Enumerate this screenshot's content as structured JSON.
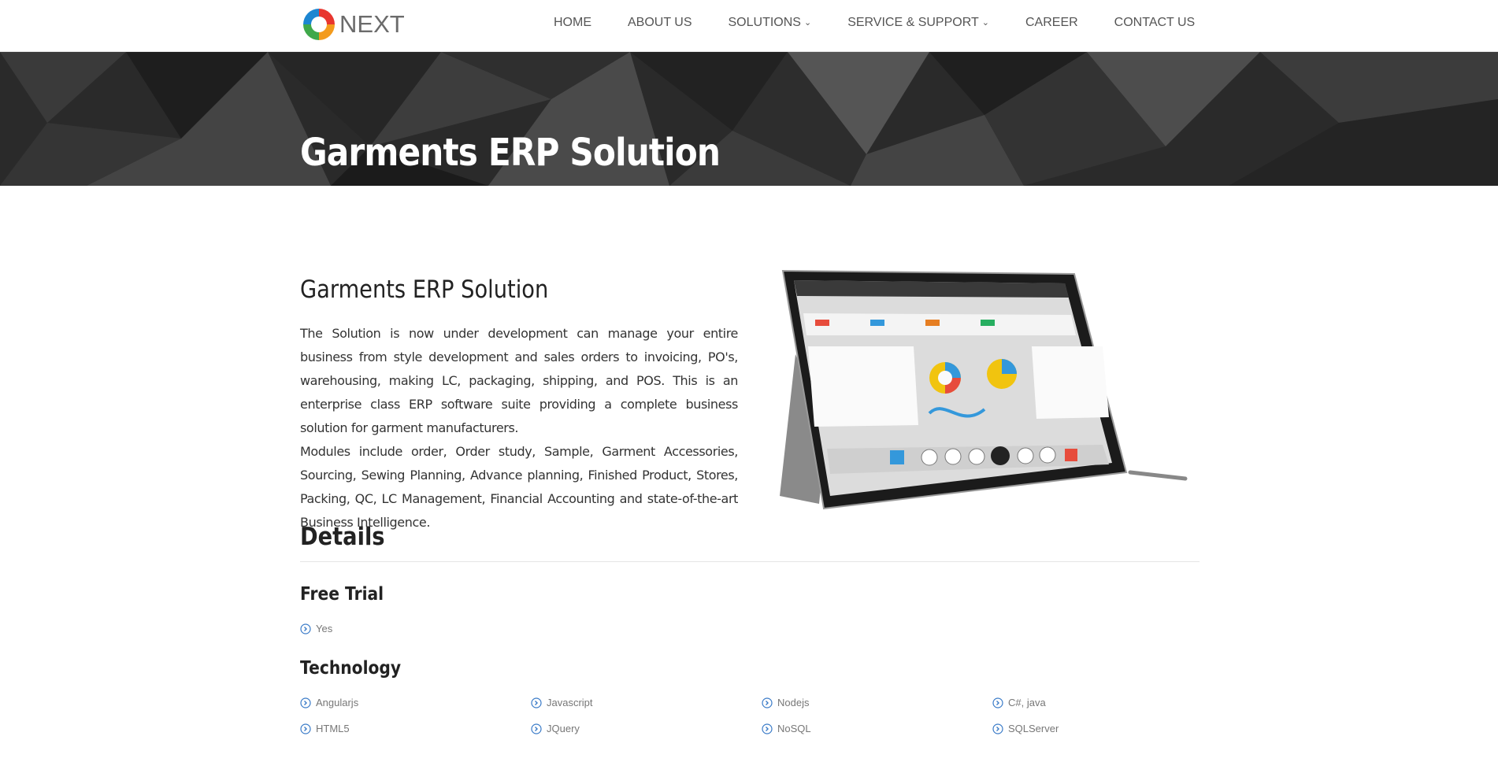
{
  "header": {
    "logo_text": "NEXT",
    "nav": [
      {
        "label": "HOME",
        "dropdown": false
      },
      {
        "label": "ABOUT US",
        "dropdown": false
      },
      {
        "label": "SOLUTIONS",
        "dropdown": true
      },
      {
        "label": "SERVICE & SUPPORT",
        "dropdown": true
      },
      {
        "label": "CAREER",
        "dropdown": false
      },
      {
        "label": "CONTACT US",
        "dropdown": false
      }
    ]
  },
  "hero": {
    "title": "Garments ERP Solution"
  },
  "main": {
    "title": "Garments ERP Solution",
    "paragraphs": [
      "The Solution is now under development can manage your entire business from style development and sales orders to invoicing, PO's, warehousing, making LC, packaging, shipping, and POS. This is an enterprise class ERP software suite providing a complete business solution for garment manufacturers.",
      "Modules include order, Order study, Sample, Garment Accessories, Sourcing, Sewing Planning, Advance planning, Finished Product, Stores, Packing, QC, LC Management, Financial Accounting and state-of-the-art Business Intelligence."
    ]
  },
  "details": {
    "title": "Details",
    "free_trial": {
      "title": "Free Trial",
      "items": [
        "Yes"
      ]
    },
    "technology": {
      "title": "Technology",
      "items": [
        "Angularjs",
        "Javascript",
        "Nodejs",
        "C#, java",
        "HTML5",
        "JQuery",
        "NoSQL",
        "SQLServer"
      ]
    }
  },
  "colors": {
    "hero_bg": "#2b2b2b",
    "icon_blue": "#3a7bc8",
    "nav_text": "#555555"
  }
}
